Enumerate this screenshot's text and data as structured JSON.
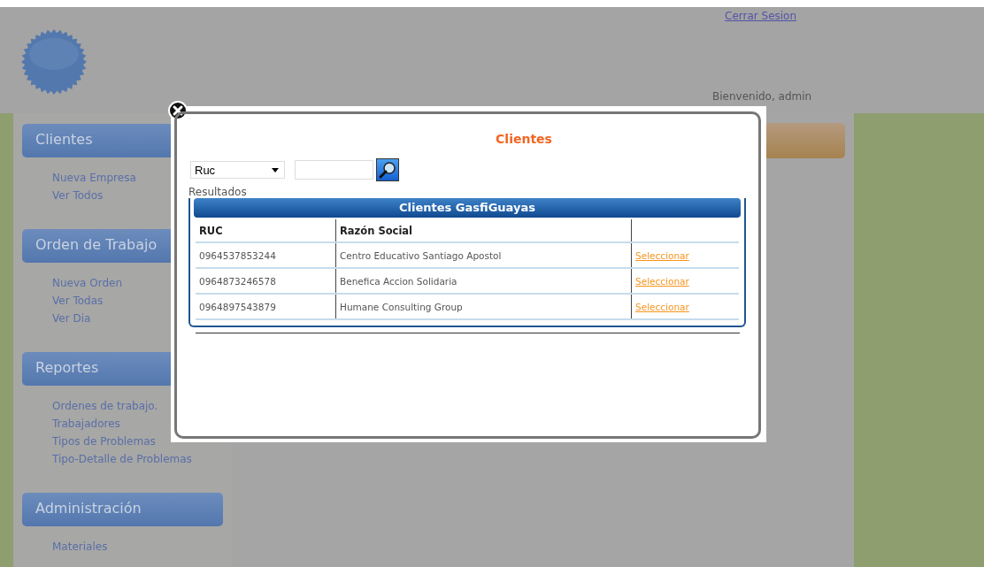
{
  "header": {
    "logout_link": "Cerrar Sesion",
    "welcome": "Bienvenido, admin"
  },
  "sidebar": {
    "sections": [
      {
        "title": "Clientes",
        "items": [
          "Nueva Empresa",
          "Ver Todos"
        ]
      },
      {
        "title": "Orden de Trabajo",
        "items": [
          "Nueva Orden",
          "Ver Todas",
          "Ver Dia"
        ]
      },
      {
        "title": "Reportes",
        "items": [
          "Ordenes de trabajo.",
          "Trabajadores",
          "Tipos de Problemas",
          "Tipo-Detalle de Problemas"
        ]
      },
      {
        "title": "Administración",
        "items": [
          "Materiales"
        ]
      }
    ]
  },
  "dialog": {
    "title": "Clientes",
    "filter": {
      "value": "Ruc"
    },
    "results_label": "Resultados",
    "table": {
      "caption": "Clientes GasfiGuayas",
      "columns": [
        "RUC",
        "Razón Social"
      ],
      "rows": [
        {
          "ruc": "0964537853244",
          "name": "Centro Educativo Santiago Apostol",
          "action": "Seleccionar"
        },
        {
          "ruc": "0964873246578",
          "name": "Benefica Accion Solidaria",
          "action": "Seleccionar"
        },
        {
          "ruc": "0964897543879",
          "name": "Humane Consulting Group",
          "action": "Seleccionar"
        }
      ]
    }
  }
}
